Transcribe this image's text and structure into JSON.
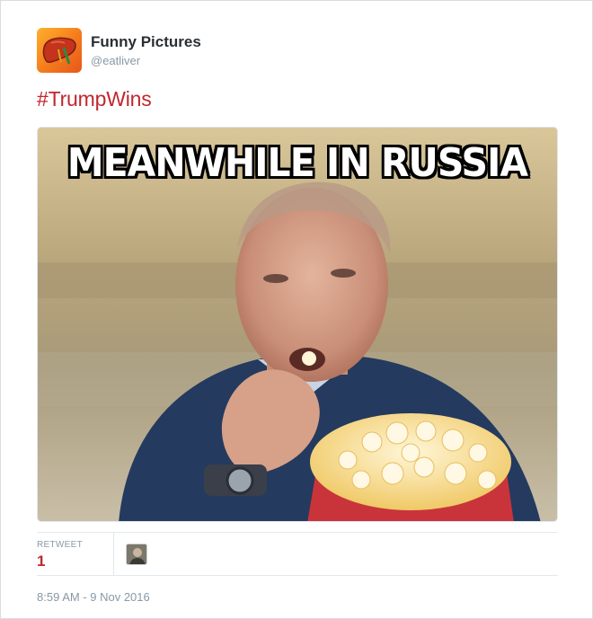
{
  "account": {
    "name": "Funny Pictures",
    "handle": "@eatliver",
    "avatar_icon": "liver-icon",
    "avatar_color": "#f47a1c"
  },
  "tweet": {
    "text": "#TrumpWins",
    "text_color": "#c1272d"
  },
  "media": {
    "caption": "MEANWHILE IN RUSSIA"
  },
  "stats": {
    "retweet_label": "RETWEET",
    "retweet_count": "1"
  },
  "timestamp": "8:59 AM - 9 Nov 2016"
}
